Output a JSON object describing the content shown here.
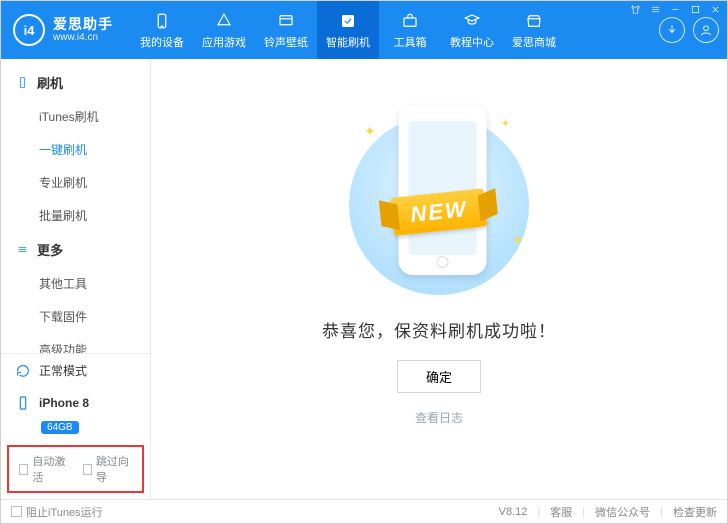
{
  "brand": {
    "logo_text": "i4",
    "name": "爱思助手",
    "url": "www.i4.cn"
  },
  "nav": [
    {
      "label": "我的设备"
    },
    {
      "label": "应用游戏"
    },
    {
      "label": "铃声壁纸"
    },
    {
      "label": "智能刷机"
    },
    {
      "label": "工具箱"
    },
    {
      "label": "教程中心"
    },
    {
      "label": "爱思商城"
    }
  ],
  "nav_active_index": 3,
  "sidebar": {
    "group1": {
      "title": "刷机",
      "items": [
        "iTunes刷机",
        "一键刷机",
        "专业刷机",
        "批量刷机"
      ],
      "active_index": 1
    },
    "group2": {
      "title": "更多",
      "items": [
        "其他工具",
        "下载固件",
        "高级功能"
      ]
    }
  },
  "mode": {
    "label": "正常模式"
  },
  "device": {
    "name": "iPhone 8",
    "capacity": "64GB"
  },
  "checks": {
    "auto_activate": "自动激活",
    "skip_guide": "跳过向导"
  },
  "main": {
    "ribbon": "NEW",
    "success_text": "恭喜您，保资料刷机成功啦！",
    "ok_button": "确定",
    "view_log": "查看日志"
  },
  "footer": {
    "block_itunes": "阻止iTunes运行",
    "version": "V8.12",
    "support": "客服",
    "wechat": "微信公众号",
    "check_update": "检查更新"
  }
}
